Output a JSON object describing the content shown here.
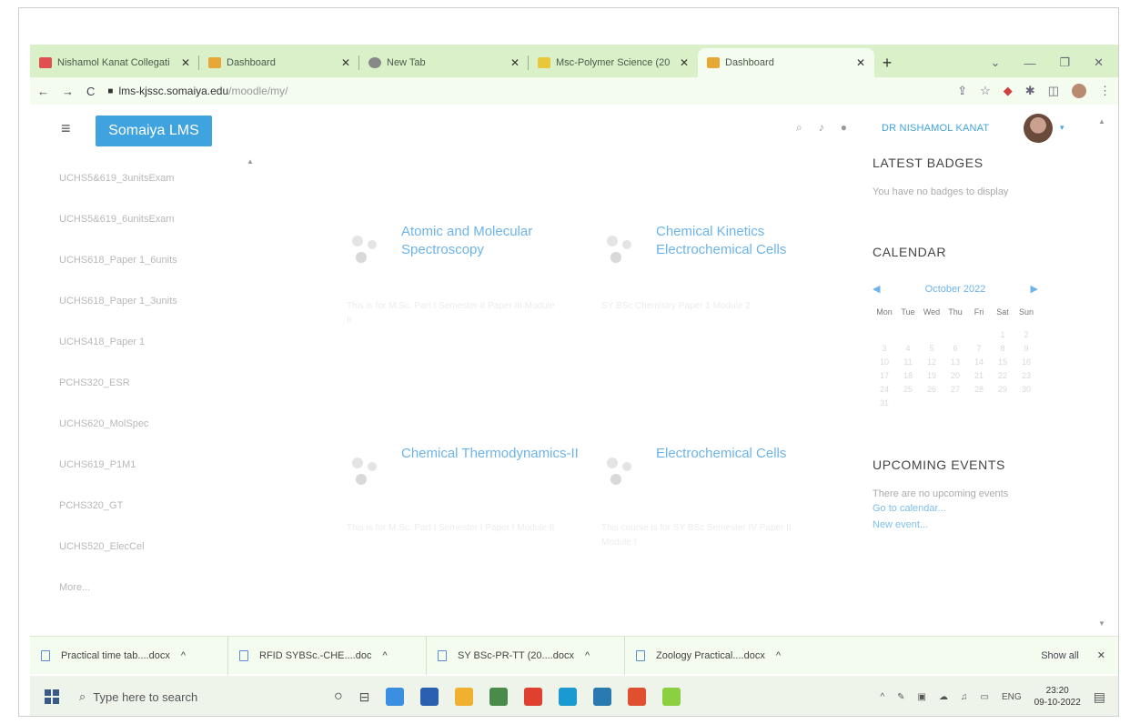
{
  "browser": {
    "tabs": [
      {
        "label": "Nishamol Kanat Collegati",
        "color": "#e05050"
      },
      {
        "label": "Dashboard",
        "color": "#e8a838"
      },
      {
        "label": "New Tab",
        "color": "#888888"
      },
      {
        "label": "Msc-Polymer Science (20",
        "color": "#e8c838"
      },
      {
        "label": "Dashboard",
        "color": "#e8a838"
      }
    ],
    "url_domain": "lms-kjssc.somaiya.edu",
    "url_path": "/moodle/my/"
  },
  "navbar": {
    "brand": "Somaiya LMS",
    "username": "DR NISHAMOL KANAT"
  },
  "sidebar": {
    "items": [
      "UCHS5&619_3unitsExam",
      "UCHS5&619_6unitsExam",
      "UCHS618_Paper 1_6units",
      "UCHS618_Paper 1_3units",
      "UCHS418_Paper 1",
      "PCHS320_ESR",
      "UCHS620_MolSpec",
      "UCHS619_P1M1",
      "PCHS320_GT",
      "UCHS520_ElecCel",
      "More..."
    ]
  },
  "courses": [
    {
      "title": "Atomic and Molecular Spectroscopy",
      "desc": "This is for M.Sc. Part I Semester II Paper III Module II"
    },
    {
      "title": "Chemical Kinetics Electrochemical Cells",
      "desc": "SY BSc Chemistry Paper 1 Module 2"
    },
    {
      "title": "Chemical Thermodynamics-II",
      "desc": "This is for M.Sc. Part I Semester I Paper I Module II"
    },
    {
      "title": "Electrochemical Cells",
      "desc": "This course is for SY BSc Semester IV Paper II Module I"
    }
  ],
  "badges": {
    "heading": "LATEST BADGES",
    "empty": "You have no badges to display"
  },
  "calendar": {
    "heading": "CALENDAR",
    "month": "October 2022",
    "weekdays": [
      "Mon",
      "Tue",
      "Wed",
      "Thu",
      "Fri",
      "Sat",
      "Sun"
    ],
    "days": [
      "",
      "",
      "",
      "",
      "",
      "1",
      "2",
      "3",
      "4",
      "5",
      "6",
      "7",
      "8",
      "9",
      "10",
      "11",
      "12",
      "13",
      "14",
      "15",
      "16",
      "17",
      "18",
      "19",
      "20",
      "21",
      "22",
      "23",
      "24",
      "25",
      "26",
      "27",
      "28",
      "29",
      "30",
      "31"
    ]
  },
  "events": {
    "heading": "UPCOMING EVENTS",
    "empty": "There are no upcoming events",
    "link1": "Go to calendar...",
    "link2": "New event..."
  },
  "downloads": {
    "items": [
      "Practical time tab....docx",
      "RFID SYBSc.-CHE....doc",
      "SY BSc-PR-TT (20....docx",
      "Zoology Practical....docx"
    ],
    "show_all": "Show all"
  },
  "taskbar": {
    "search_placeholder": "Type here to search",
    "lang": "ENG",
    "time": "23:20",
    "date": "09-10-2022",
    "app_colors": [
      "#3a8fe0",
      "#2b5fb0",
      "#f0b030",
      "#4a8a4a",
      "#e04030",
      "#1a9ad0",
      "#2a7ab0",
      "#e05030",
      "#8ad040"
    ]
  }
}
